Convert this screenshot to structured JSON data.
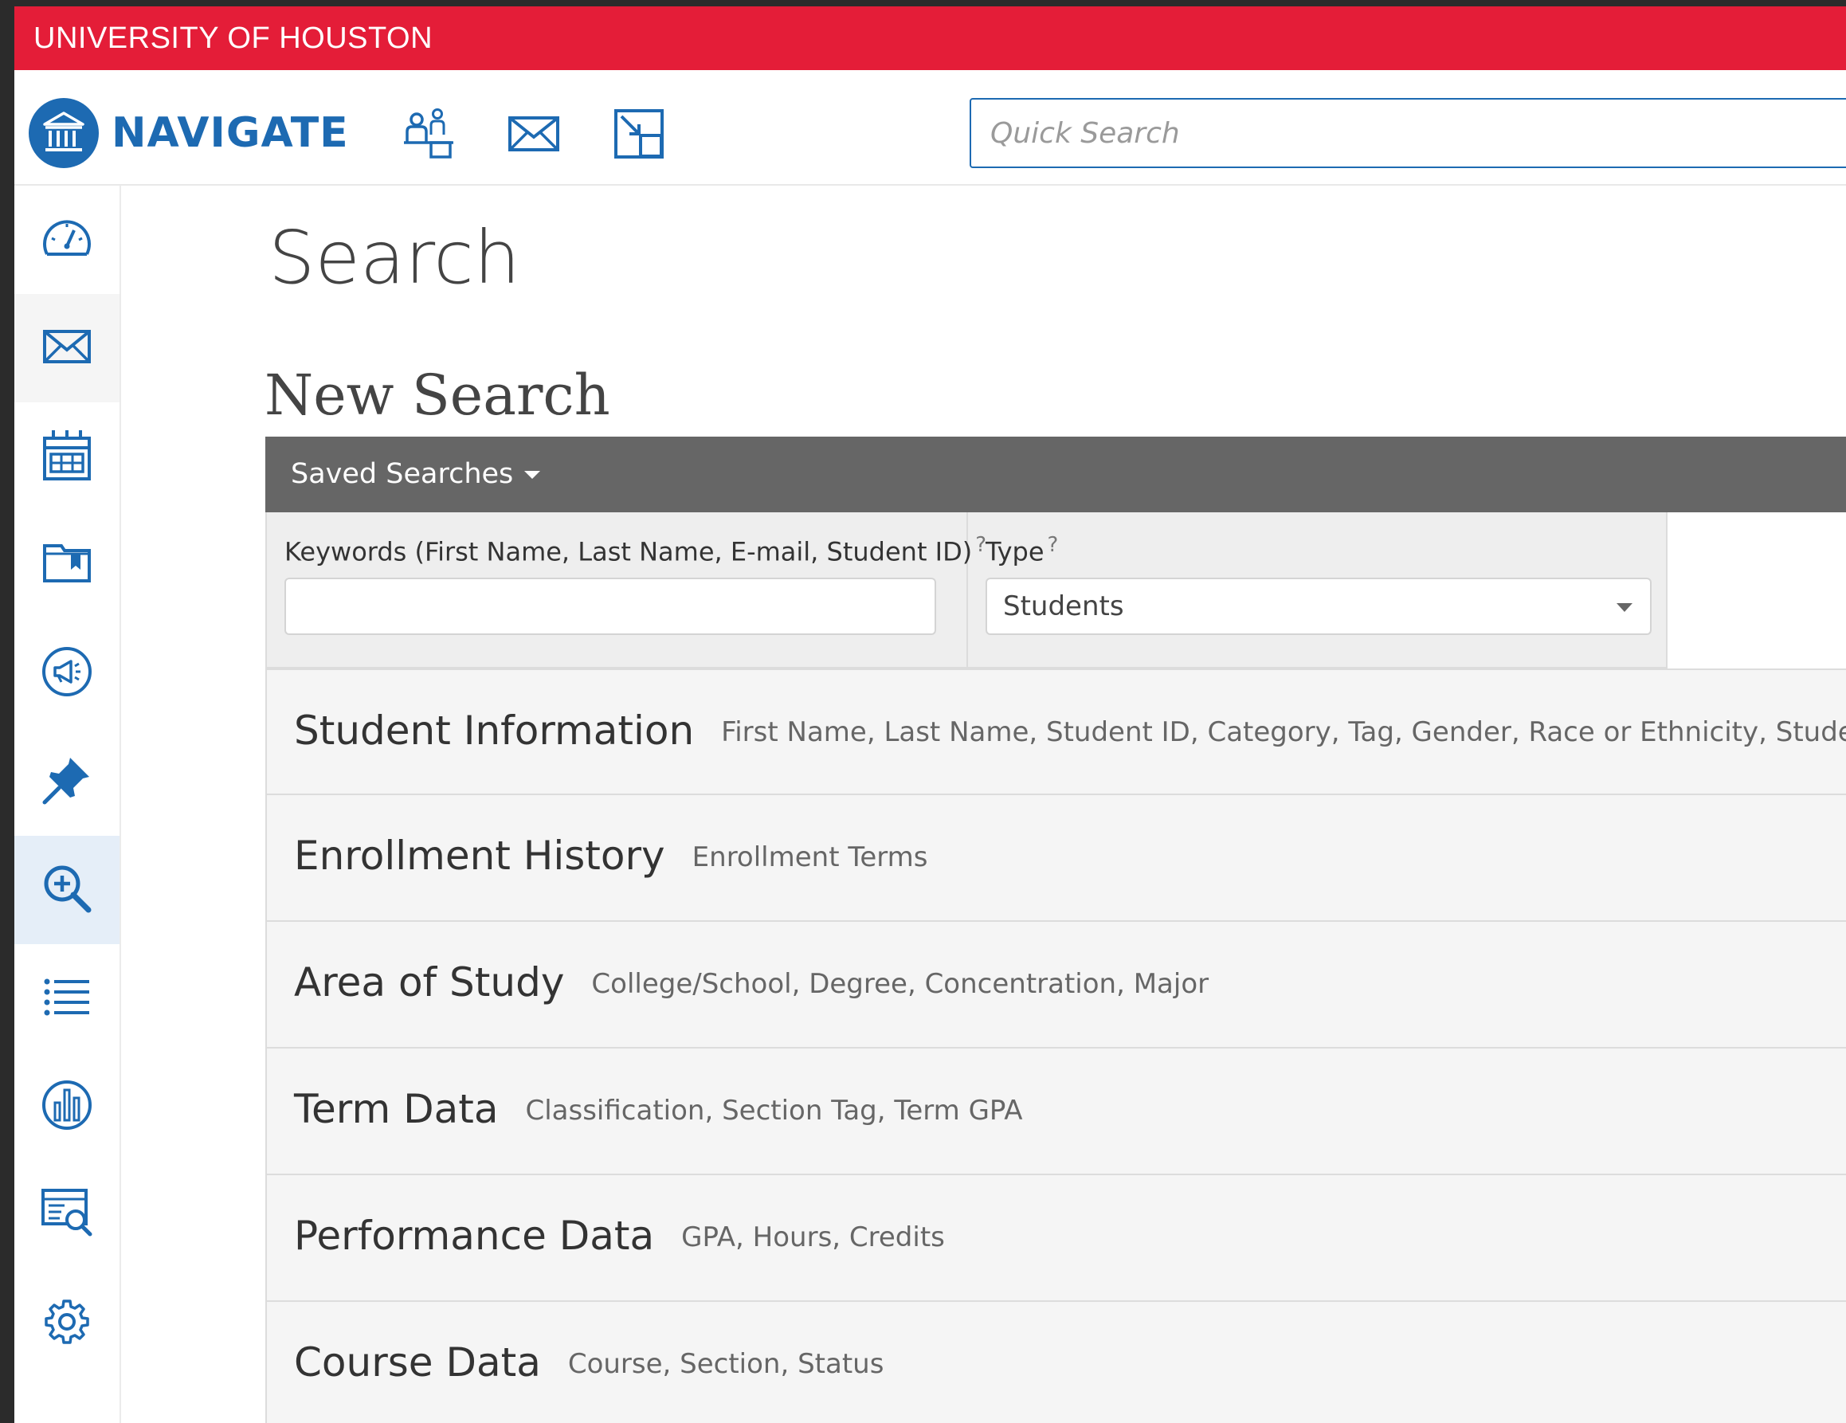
{
  "university_bar": {
    "text": "UNIVERSITY OF HOUSTON"
  },
  "header": {
    "logo_text": "NAVIGATE",
    "search_placeholder": "Quick Search"
  },
  "page": {
    "title": "Search",
    "section_title": "New Search",
    "saved_searches_label": "Saved Searches"
  },
  "filters": {
    "keywords_label": "Keywords (First Name, Last Name, E-mail, Student ID)",
    "keywords_help": "?",
    "type_label": "Type",
    "type_help": "?",
    "type_value": "Students"
  },
  "accordion": [
    {
      "title": "Student Information",
      "subtitle": "First Name, Last Name, Student ID, Category, Tag, Gender, Race or Ethnicity, Student List"
    },
    {
      "title": "Enrollment History",
      "subtitle": "Enrollment Terms"
    },
    {
      "title": "Area of Study",
      "subtitle": "College/School, Degree, Concentration, Major"
    },
    {
      "title": "Term Data",
      "subtitle": "Classification, Section Tag, Term GPA"
    },
    {
      "title": "Performance Data",
      "subtitle": "GPA, Hours, Credits"
    },
    {
      "title": "Course Data",
      "subtitle": "Course, Section, Status"
    }
  ],
  "sidebar": {
    "icons": [
      "dashboard-icon",
      "mail-icon",
      "calendar-icon",
      "folder-icon",
      "megaphone-icon",
      "pin-icon",
      "search-zoom-icon",
      "list-icon",
      "analytics-icon",
      "report-search-icon",
      "gear-icon"
    ],
    "active": "search-zoom-icon"
  },
  "colors": {
    "brand_red": "#e41d38",
    "brand_blue": "#1d6ab2",
    "saved_bar": "#666666"
  }
}
